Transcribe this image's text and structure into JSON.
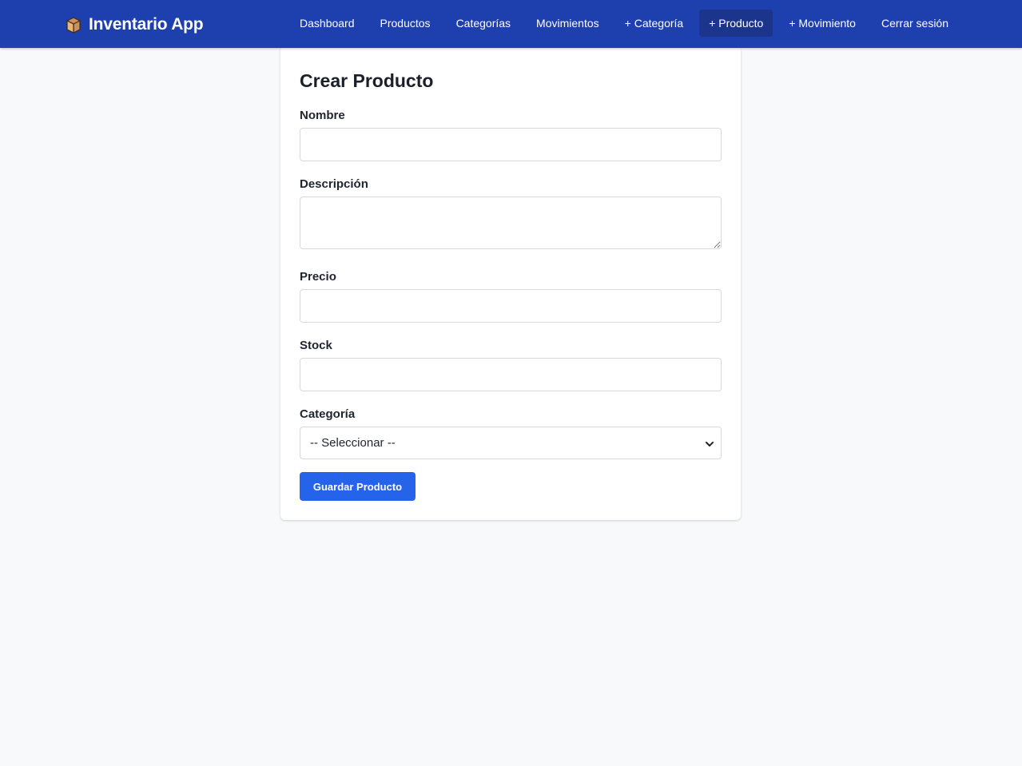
{
  "app": {
    "title": "Inventario App",
    "brand_icon": "package-box-icon",
    "colors": {
      "navbar": "#1e40af",
      "active_link": "#1b348c",
      "primary_button": "#2563eb",
      "page_background": "#f8f9fb"
    }
  },
  "nav": {
    "items": [
      {
        "label": "Dashboard",
        "active": false
      },
      {
        "label": "Productos",
        "active": false
      },
      {
        "label": "Categorías",
        "active": false
      },
      {
        "label": "Movimientos",
        "active": false
      },
      {
        "label": "+ Categoría",
        "active": false
      },
      {
        "label": "+ Producto",
        "active": true
      },
      {
        "label": "+ Movimiento",
        "active": false
      },
      {
        "label": "Cerrar sesión",
        "active": false
      }
    ]
  },
  "form": {
    "title": "Crear Producto",
    "fields": {
      "nombre": {
        "label": "Nombre",
        "value": ""
      },
      "descripcion": {
        "label": "Descripción",
        "value": ""
      },
      "precio": {
        "label": "Precio",
        "value": ""
      },
      "stock": {
        "label": "Stock",
        "value": ""
      },
      "categoria": {
        "label": "Categoría",
        "selected": "-- Seleccionar --"
      }
    },
    "submit_label": "Guardar Producto"
  }
}
